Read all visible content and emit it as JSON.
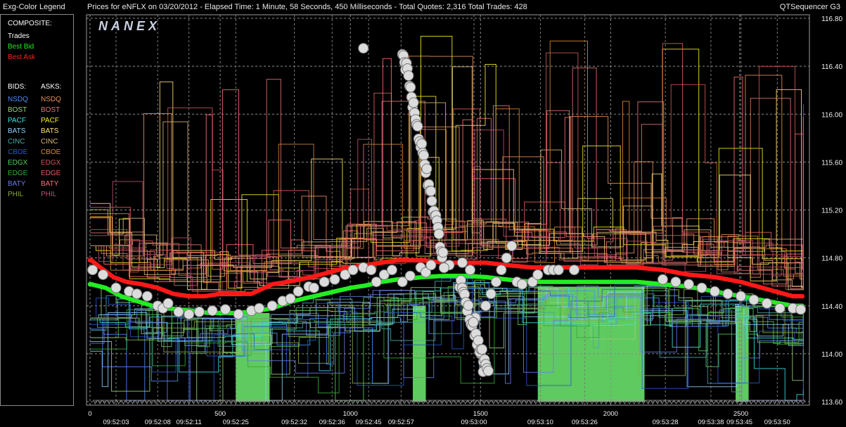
{
  "header": {
    "legend_title": "Exg-Color Legend",
    "chart_title": "Prices for  eNFLX  on  03/20/2012  -  Elapsed Time: 1 Minute, 58 Seconds, 450 Milliseconds  -  Total Quotes: 2,316  Total Trades: 428",
    "app_name": "QTSequencer G3"
  },
  "legend": {
    "composite_label": "COMPOSITE:",
    "composite_items": [
      {
        "label": "Trades",
        "color": "#ffffff"
      },
      {
        "label": "Best Bid",
        "color": "#22ee22"
      },
      {
        "label": "Best Ask",
        "color": "#ff2020"
      }
    ],
    "bids_label": "BIDS:",
    "asks_label": "ASKS:",
    "bids": [
      {
        "label": "NSDQ",
        "color": "#4a8cff"
      },
      {
        "label": "BOST",
        "color": "#9ad07a"
      },
      {
        "label": "PACF",
        "color": "#3ee0e0"
      },
      {
        "label": "BATS",
        "color": "#8ed0ff"
      },
      {
        "label": "CINC",
        "color": "#4fa8a8"
      },
      {
        "label": "CBOE",
        "color": "#2a58c8"
      },
      {
        "label": "EDGX",
        "color": "#58c858"
      },
      {
        "label": "EDGE",
        "color": "#38a838"
      },
      {
        "label": "BATY",
        "color": "#6a7ae8"
      },
      {
        "label": "PHIL",
        "color": "#8aa84a"
      }
    ],
    "asks": [
      {
        "label": "NSDQ",
        "color": "#e8905a"
      },
      {
        "label": "BOST",
        "color": "#e07878"
      },
      {
        "label": "PACF",
        "color": "#f4f020"
      },
      {
        "label": "BATS",
        "color": "#ffe070"
      },
      {
        "label": "CINC",
        "color": "#d8b878"
      },
      {
        "label": "CBOE",
        "color": "#d88838"
      },
      {
        "label": "EDGX",
        "color": "#c85858"
      },
      {
        "label": "EDGE",
        "color": "#e06060"
      },
      {
        "label": "BATY",
        "color": "#ff7070"
      },
      {
        "label": "PHIL",
        "color": "#c05070"
      }
    ]
  },
  "watermark": "NANEX",
  "chart_data": {
    "type": "line",
    "title": "Prices for  eNFLX  on  03/20/2012",
    "ylim": [
      113.6,
      116.8
    ],
    "xlim": [
      0,
      2750
    ],
    "grid": true,
    "y_ticks": [
      "116.80",
      "116.40",
      "116.00",
      "115.60",
      "115.20",
      "114.80",
      "114.40",
      "114.00",
      "113.60"
    ],
    "x_ticks_sequence": [
      0,
      500,
      1000,
      1500,
      2000,
      2500
    ],
    "x_time_labels": [
      {
        "seq": 100,
        "label": "09:52:03"
      },
      {
        "seq": 260,
        "label": "09:52:08"
      },
      {
        "seq": 380,
        "label": "09:52:11"
      },
      {
        "seq": 560,
        "label": "09:52:25"
      },
      {
        "seq": 785,
        "label": "09:52:32"
      },
      {
        "seq": 930,
        "label": "09:52:36"
      },
      {
        "seq": 1070,
        "label": "09:52:45"
      },
      {
        "seq": 1195,
        "label": "09:52:57"
      },
      {
        "seq": 1475,
        "label": "09:53:00"
      },
      {
        "seq": 1730,
        "label": "09:53:10"
      },
      {
        "seq": 1900,
        "label": "09:53:26"
      },
      {
        "seq": 2210,
        "label": "09:53:28"
      },
      {
        "seq": 2385,
        "label": "09:53:38"
      },
      {
        "seq": 2495,
        "label": "09:53:45"
      },
      {
        "seq": 2640,
        "label": "09:53:50"
      }
    ],
    "series": [
      {
        "name": "Best Ask",
        "color": "#ff1818",
        "points": [
          [
            5,
            114.78
          ],
          [
            40,
            114.72
          ],
          [
            90,
            114.64
          ],
          [
            140,
            114.6
          ],
          [
            200,
            114.58
          ],
          [
            260,
            114.55
          ],
          [
            320,
            114.5
          ],
          [
            380,
            114.48
          ],
          [
            440,
            114.48
          ],
          [
            500,
            114.5
          ],
          [
            560,
            114.5
          ],
          [
            620,
            114.5
          ],
          [
            700,
            114.58
          ],
          [
            760,
            114.6
          ],
          [
            850,
            114.64
          ],
          [
            920,
            114.68
          ],
          [
            990,
            114.72
          ],
          [
            1060,
            114.74
          ],
          [
            1120,
            114.76
          ],
          [
            1180,
            114.78
          ],
          [
            1280,
            114.78
          ],
          [
            1360,
            114.76
          ],
          [
            1440,
            114.76
          ],
          [
            1520,
            114.76
          ],
          [
            1600,
            114.74
          ],
          [
            1700,
            114.72
          ],
          [
            1800,
            114.72
          ],
          [
            1900,
            114.72
          ],
          [
            2000,
            114.72
          ],
          [
            2100,
            114.72
          ],
          [
            2200,
            114.7
          ],
          [
            2300,
            114.66
          ],
          [
            2400,
            114.64
          ],
          [
            2500,
            114.6
          ],
          [
            2600,
            114.54
          ],
          [
            2700,
            114.48
          ],
          [
            2740,
            114.48
          ]
        ]
      },
      {
        "name": "Best Bid",
        "color": "#22ee22",
        "points": [
          [
            5,
            114.58
          ],
          [
            60,
            114.55
          ],
          [
            120,
            114.48
          ],
          [
            180,
            114.44
          ],
          [
            240,
            114.4
          ],
          [
            300,
            114.38
          ],
          [
            380,
            114.36
          ],
          [
            460,
            114.34
          ],
          [
            560,
            114.34
          ],
          [
            620,
            114.35
          ],
          [
            700,
            114.38
          ],
          [
            780,
            114.44
          ],
          [
            860,
            114.48
          ],
          [
            940,
            114.52
          ],
          [
            1000,
            114.55
          ],
          [
            1060,
            114.57
          ],
          [
            1120,
            114.6
          ],
          [
            1180,
            114.62
          ],
          [
            1280,
            114.64
          ],
          [
            1360,
            114.65
          ],
          [
            1440,
            114.65
          ],
          [
            1520,
            114.64
          ],
          [
            1600,
            114.62
          ],
          [
            1700,
            114.6
          ],
          [
            1800,
            114.6
          ],
          [
            1900,
            114.6
          ],
          [
            2000,
            114.6
          ],
          [
            2100,
            114.6
          ],
          [
            2200,
            114.58
          ],
          [
            2300,
            114.56
          ],
          [
            2400,
            114.52
          ],
          [
            2500,
            114.48
          ],
          [
            2600,
            114.44
          ],
          [
            2700,
            114.4
          ],
          [
            2740,
            114.4
          ]
        ]
      }
    ],
    "trades": [
      [
        10,
        114.7
      ],
      [
        50,
        114.66
      ],
      [
        100,
        114.55
      ],
      [
        150,
        114.52
      ],
      [
        180,
        114.5
      ],
      [
        220,
        114.48
      ],
      [
        260,
        114.4
      ],
      [
        280,
        114.38
      ],
      [
        300,
        114.42
      ],
      [
        340,
        114.35
      ],
      [
        380,
        114.33
      ],
      [
        420,
        114.35
      ],
      [
        470,
        114.36
      ],
      [
        520,
        114.37
      ],
      [
        570,
        114.33
      ],
      [
        620,
        114.36
      ],
      [
        650,
        114.38
      ],
      [
        700,
        114.4
      ],
      [
        740,
        114.44
      ],
      [
        770,
        114.46
      ],
      [
        800,
        114.52
      ],
      [
        840,
        114.56
      ],
      [
        860,
        114.55
      ],
      [
        900,
        114.6
      ],
      [
        940,
        114.62
      ],
      [
        980,
        114.66
      ],
      [
        1010,
        114.7
      ],
      [
        1050,
        114.72
      ],
      [
        1080,
        114.7
      ],
      [
        1100,
        114.6
      ],
      [
        1130,
        114.66
      ],
      [
        1160,
        114.7
      ],
      [
        1200,
        114.6
      ],
      [
        1230,
        114.65
      ],
      [
        1270,
        114.72
      ],
      [
        1290,
        114.68
      ],
      [
        1310,
        114.74
      ],
      [
        1380,
        114.74
      ],
      [
        1430,
        114.76
      ],
      [
        1460,
        114.7
      ],
      [
        1480,
        114.3
      ],
      [
        1500,
        114.0
      ],
      [
        1510,
        113.85
      ],
      [
        1520,
        114.4
      ],
      [
        1540,
        114.5
      ],
      [
        1560,
        114.6
      ],
      [
        1580,
        114.7
      ],
      [
        1600,
        114.8
      ],
      [
        1620,
        114.9
      ],
      [
        1640,
        114.6
      ],
      [
        1660,
        114.58
      ],
      [
        1700,
        114.6
      ],
      [
        1720,
        114.66
      ],
      [
        1760,
        114.7
      ],
      [
        1780,
        114.7
      ],
      [
        1800,
        114.7
      ],
      [
        1860,
        114.7
      ],
      [
        2200,
        114.62
      ],
      [
        2250,
        114.6
      ],
      [
        2300,
        114.58
      ],
      [
        2350,
        114.55
      ],
      [
        2400,
        114.52
      ],
      [
        2450,
        114.5
      ],
      [
        2500,
        114.48
      ],
      [
        2550,
        114.45
      ],
      [
        2600,
        114.42
      ],
      [
        2650,
        114.38
      ],
      [
        2700,
        114.38
      ],
      [
        2730,
        114.37
      ]
    ],
    "trade_excursion_seq": [
      1180,
      1540
    ],
    "trade_excursion_high": 116.55,
    "trade_excursion_low": 113.82
  }
}
